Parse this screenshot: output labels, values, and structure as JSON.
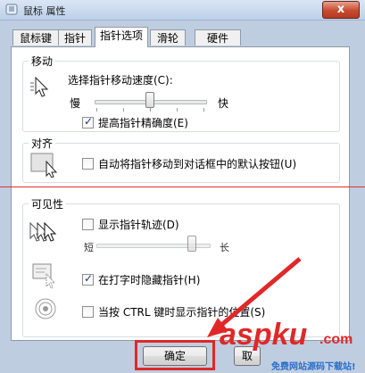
{
  "window": {
    "title": "鼠标 属性",
    "close_glyph": "x"
  },
  "tabs": [
    {
      "label": "鼠标键",
      "active": false
    },
    {
      "label": "指针",
      "active": false
    },
    {
      "label": "指针选项",
      "active": true
    },
    {
      "label": "滑轮",
      "active": false
    },
    {
      "label": "硬件",
      "active": false
    }
  ],
  "motion": {
    "group_label": "移动",
    "speed_label": "选择指针移动速度(C):",
    "slow": "慢",
    "fast": "快",
    "speed_level": 0.5,
    "precision_label": "提高指针精确度(E)",
    "precision_checked": true
  },
  "snap": {
    "group_label": "对齐",
    "label": "自动将指针移动到对话框中的默认按钮(U)",
    "checked": false
  },
  "visibility": {
    "group_label": "可见性",
    "trails_label": "显示指针轨迹(D)",
    "trails_checked": false,
    "short": "短",
    "long": "长",
    "trail_level": 0.85,
    "hide_label": "在打字时隐藏指针(H)",
    "hide_checked": true,
    "ctrl_label": "当按 CTRL 键时显示指针的位置(S)",
    "ctrl_checked": false
  },
  "footer": {
    "ok_label": "确定",
    "partial_label": "取"
  },
  "watermark": {
    "brand": "aspku",
    "domain": ".com",
    "caption": "免费网站源码下载站!"
  },
  "colors": {
    "annotation_red": "#e02828",
    "accent_blue": "#2a6fc9"
  }
}
